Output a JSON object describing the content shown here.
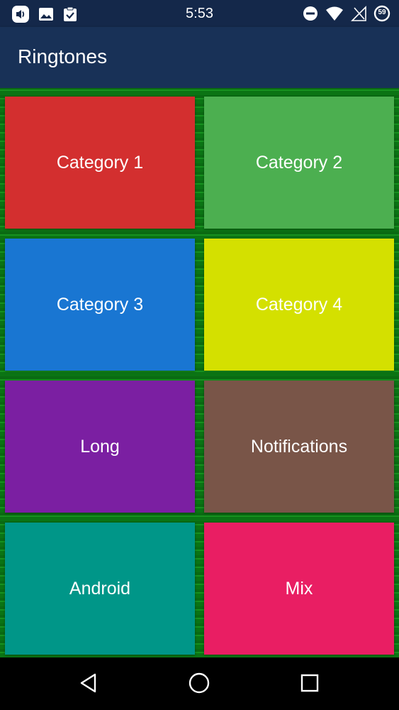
{
  "status_bar": {
    "time": "5:53",
    "battery_level": "59",
    "left_icons": [
      "volume-icon",
      "image-icon",
      "clipboard-check-icon"
    ],
    "right_icons": [
      "do-not-disturb-icon",
      "wifi-icon",
      "no-sim-icon",
      "battery-icon"
    ]
  },
  "app_bar": {
    "title": "Ringtones",
    "color": "#183157"
  },
  "tiles": [
    {
      "label": "Category 1",
      "color": "#d32f2f"
    },
    {
      "label": "Category 2",
      "color": "#4caf50"
    },
    {
      "label": "Category 3",
      "color": "#1976d2"
    },
    {
      "label": "Category 4",
      "color": "#d4e000"
    },
    {
      "label": "Long",
      "color": "#7b1fa2"
    },
    {
      "label": "Notifications",
      "color": "#795548"
    },
    {
      "label": "Android",
      "color": "#009688"
    },
    {
      "label": "Mix",
      "color": "#e91e63"
    }
  ],
  "background_color": "#0a6a12",
  "nav_bar": {
    "buttons": [
      "back-icon",
      "home-icon",
      "recents-icon"
    ]
  }
}
